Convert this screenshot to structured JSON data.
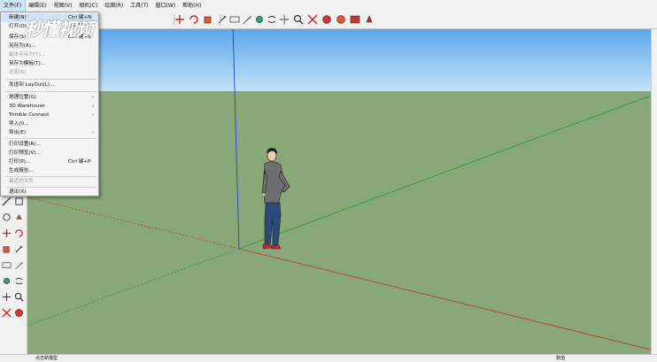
{
  "menubar": [
    {
      "label": "文件(F)",
      "active": true
    },
    {
      "label": "编辑(E)"
    },
    {
      "label": "视图(V)"
    },
    {
      "label": "相机(C)"
    },
    {
      "label": "绘图(R)"
    },
    {
      "label": "工具(T)"
    },
    {
      "label": "窗口(W)"
    },
    {
      "label": "帮助(H)"
    }
  ],
  "file_menu": {
    "new": {
      "label": "新建(N)",
      "shortcut": "Ctrl 键+N"
    },
    "open": {
      "label": "打开(O)...",
      "shortcut": "Ctrl 键+O"
    },
    "save": {
      "label": "保存(S)",
      "shortcut": "Ctrl 键+S"
    },
    "save_as": {
      "label": "另存为(A)..."
    },
    "save_copy": {
      "label": "副本另存为(Y)..."
    },
    "save_template": {
      "label": "另存为模板(T)..."
    },
    "revert": {
      "label": "还原(R)"
    },
    "send_layout": {
      "label": "发送到 LayOut(L)..."
    },
    "geo_location": {
      "label": "地理位置(G)"
    },
    "warehouse": {
      "label": "3D Warehouse"
    },
    "trimble": {
      "label": "Trimble Connect"
    },
    "import": {
      "label": "导入(I)..."
    },
    "export": {
      "label": "导出(E)"
    },
    "print_setup": {
      "label": "打印设置(R)..."
    },
    "print_preview": {
      "label": "打印预览(V)..."
    },
    "print": {
      "label": "打印(P)...",
      "shortcut": "Ctrl 键+P"
    },
    "report": {
      "label": "生成报告..."
    },
    "recent": {
      "label": "最近的文件"
    },
    "exit": {
      "label": "退出(X)"
    }
  },
  "watermark": {
    "text": "秒懂视频"
  },
  "statusbar": {
    "left": "点击新模型",
    "right": "数值"
  },
  "colors": {
    "sky_top": "#5aa8ea",
    "sky_bottom": "#c4e2f7",
    "ground": "#88a87a",
    "highlight": "#cfe3f6",
    "axis_red": "#c0392b",
    "axis_green": "#2e9a2e",
    "axis_blue": "#2a3fc8"
  },
  "icons": {
    "toolbar": [
      "select-icon",
      "eraser-icon",
      "paint-icon",
      "line-icon",
      "rectangle-icon",
      "circle-icon",
      "push-pull-icon",
      "move-icon",
      "rotate-icon",
      "scale-icon",
      "offset-icon",
      "tape-icon",
      "text-icon",
      "paint-bucket-icon",
      "orbit-icon",
      "pan-icon",
      "zoom-icon",
      "zoom-extents-icon",
      "warehouse-icon",
      "extension-icon",
      "send-icon",
      "ruby-icon"
    ],
    "left": [
      "tape-measure-icon",
      "protractor-icon",
      "pencil-icon",
      "text-tool-icon",
      "axes-icon",
      "dimension-icon",
      "orbit-tool-icon",
      "walk-icon",
      "zoom-tool-icon",
      "zoom-window-icon",
      "zoom-extents-tool-icon",
      "magnify-icon",
      "position-camera-icon",
      "look-around-icon",
      "footprint-icon",
      "section-icon"
    ]
  }
}
